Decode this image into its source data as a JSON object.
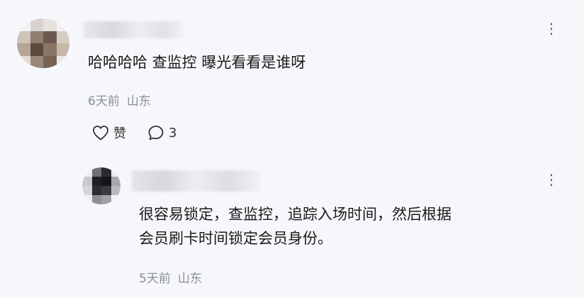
{
  "comment": {
    "text": "哈哈哈哈 查监控 曝光看看是谁呀",
    "time": "6天前",
    "location": "山东",
    "like_label": "赞",
    "reply_count": "3",
    "more_icon": "more-dots-icon"
  },
  "reply": {
    "text_lines": [
      "很容易锁定，查监控，追踪入场时间，然后根据",
      "会员刷卡时间锁定会员身份。"
    ],
    "time": "5天前",
    "location": "山东",
    "more_icon": "more-dots-icon"
  }
}
